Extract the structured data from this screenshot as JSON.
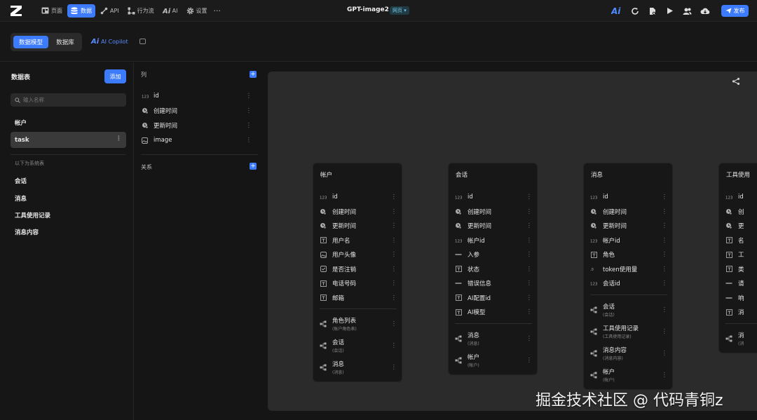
{
  "header": {
    "nav": [
      {
        "label": "页面",
        "icon": "page-icon",
        "active": false
      },
      {
        "label": "数据",
        "icon": "database-icon",
        "active": true
      },
      {
        "label": "API",
        "icon": "api-icon",
        "active": false
      },
      {
        "label": "行为流",
        "icon": "flow-icon",
        "active": false
      },
      {
        "label": "AI",
        "icon": "ai-icon",
        "active": false
      },
      {
        "label": "设置",
        "icon": "gear-icon",
        "active": false
      }
    ],
    "more": "···",
    "app_title": "GPT-image2",
    "env_badge": "网页 ▾",
    "publish": "发布"
  },
  "subbar": {
    "tab_model": "数据模型",
    "tab_db": "数据库",
    "copilot_prefix": "Ai",
    "copilot": "AI Copilot"
  },
  "sidebar": {
    "title": "数据表",
    "add": "添加",
    "search_placeholder": "输入名称",
    "tables": [
      "帐户",
      "task"
    ],
    "system_label": "以下为系统表",
    "system_tables": [
      "会话",
      "消息",
      "工具使用记录",
      "消息内容"
    ]
  },
  "columns": {
    "title": "列",
    "rows": [
      {
        "icon": "number-icon",
        "name": "id"
      },
      {
        "icon": "clock-icon",
        "name": "创建时间"
      },
      {
        "icon": "clock-icon",
        "name": "更新时间"
      },
      {
        "icon": "image-icon",
        "name": "image"
      }
    ],
    "relations_title": "关系"
  },
  "cards": [
    {
      "title": "帐户",
      "fields": [
        {
          "icon": "number-icon",
          "name": "id"
        },
        {
          "icon": "clock-icon",
          "name": "创建时间"
        },
        {
          "icon": "clock-icon",
          "name": "更新时间"
        },
        {
          "icon": "text-icon",
          "name": "用户名"
        },
        {
          "icon": "image-icon",
          "name": "用户头像"
        },
        {
          "icon": "checkbox-icon",
          "name": "是否注销"
        },
        {
          "icon": "text-icon",
          "name": "电话号码"
        },
        {
          "icon": "text-icon",
          "name": "邮箱"
        }
      ],
      "relations": [
        {
          "name": "角色列表",
          "sub": "(账户角色表)"
        },
        {
          "name": "会话",
          "sub": "(会话)"
        },
        {
          "name": "消息",
          "sub": "(消息)"
        }
      ]
    },
    {
      "title": "会话",
      "fields": [
        {
          "icon": "number-icon",
          "name": "id"
        },
        {
          "icon": "clock-icon",
          "name": "创建时间"
        },
        {
          "icon": "clock-icon",
          "name": "更新时间"
        },
        {
          "icon": "number-icon",
          "name": "帐户id"
        },
        {
          "icon": "json-icon",
          "name": "入参"
        },
        {
          "icon": "text-icon",
          "name": "状态"
        },
        {
          "icon": "json-icon",
          "name": "错误信息"
        },
        {
          "icon": "text-icon",
          "name": "AI配置id"
        },
        {
          "icon": "text-icon",
          "name": "AI模型"
        }
      ],
      "relations": [
        {
          "name": "消息",
          "sub": "(消息)"
        },
        {
          "name": "帐户",
          "sub": "(帐户)"
        }
      ]
    },
    {
      "title": "消息",
      "fields": [
        {
          "icon": "number-icon",
          "name": "id"
        },
        {
          "icon": "clock-icon",
          "name": "创建时间"
        },
        {
          "icon": "clock-icon",
          "name": "更新时间"
        },
        {
          "icon": "number-icon",
          "name": "帐户id"
        },
        {
          "icon": "text-icon",
          "name": "角色"
        },
        {
          "icon": "decimal-icon",
          "name": "token使用量"
        },
        {
          "icon": "number-icon",
          "name": "会话id"
        }
      ],
      "relations": [
        {
          "name": "会话",
          "sub": "(会话)"
        },
        {
          "name": "工具使用记录",
          "sub": "(工具使用记录)"
        },
        {
          "name": "消息内容",
          "sub": "(消息内容)"
        },
        {
          "name": "帐户",
          "sub": "(帐户)"
        }
      ]
    },
    {
      "title": "工具使用",
      "fields": [
        {
          "icon": "number-icon",
          "name": "id"
        },
        {
          "icon": "clock-icon",
          "name": "创"
        },
        {
          "icon": "clock-icon",
          "name": "更"
        },
        {
          "icon": "text-icon",
          "name": "名"
        },
        {
          "icon": "text-icon",
          "name": "工"
        },
        {
          "icon": "text-icon",
          "name": "类"
        },
        {
          "icon": "json-icon",
          "name": "请"
        },
        {
          "icon": "json-icon",
          "name": "响"
        },
        {
          "icon": "text-icon",
          "name": "消"
        }
      ],
      "relations": [
        {
          "name": "消",
          "sub": "(消"
        }
      ]
    }
  ],
  "watermark": "掘金技术社区 @ 代码青铜z",
  "colors": {
    "accent": "#3d7bfd",
    "background": "#151515",
    "canvas": "#2b2b2b",
    "card": "#171717"
  }
}
